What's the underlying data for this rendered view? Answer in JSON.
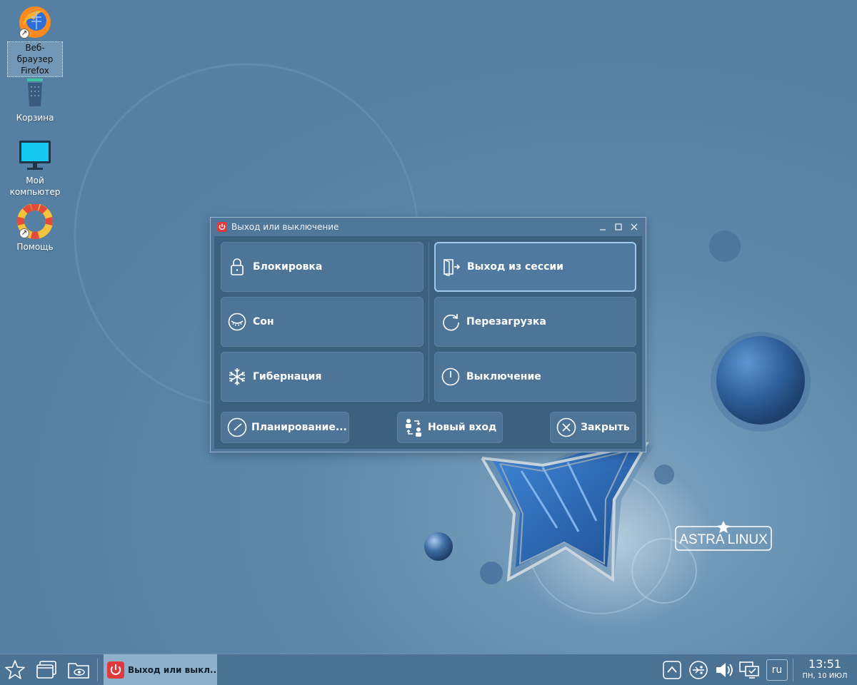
{
  "desktop": {
    "icons": [
      {
        "label": "Веб-браузер Firefox",
        "icon": "firefox-icon"
      },
      {
        "label": "Корзина",
        "icon": "trash-icon"
      },
      {
        "label": "Мой компьютер",
        "icon": "monitor-icon"
      },
      {
        "label": "Помощь",
        "icon": "lifebuoy-icon"
      }
    ],
    "brand": "ASTRA LINUX"
  },
  "dialog": {
    "title": "Выход или выключение",
    "options": {
      "lock": "Блокировка",
      "logout": "Выход из сессии",
      "sleep": "Сон",
      "reboot": "Перезагрузка",
      "hibernate": "Гибернация",
      "shutdown": "Выключение"
    },
    "bottom": {
      "schedule": "Планирование...",
      "new_login": "Новый вход",
      "close": "Закрыть"
    },
    "focused_option": "logout"
  },
  "taskbar": {
    "task_title": "Выход или выкл...",
    "tray_icons": [
      "chevron-up-icon",
      "network-icon",
      "volume-icon",
      "display-icon"
    ],
    "language": "ru",
    "clock": {
      "time": "13:51",
      "date": "ПН, 10 ИЮЛ"
    }
  },
  "colors": {
    "desktop_bg": "#5a86a8",
    "dialog_body": "#3e607f",
    "button_bg": "#4e7597",
    "focus_border": "#9ec9ef",
    "taskbar_bg": "#4b7193",
    "active_task": "#8fb0cb",
    "power_red": "#e0393e"
  }
}
